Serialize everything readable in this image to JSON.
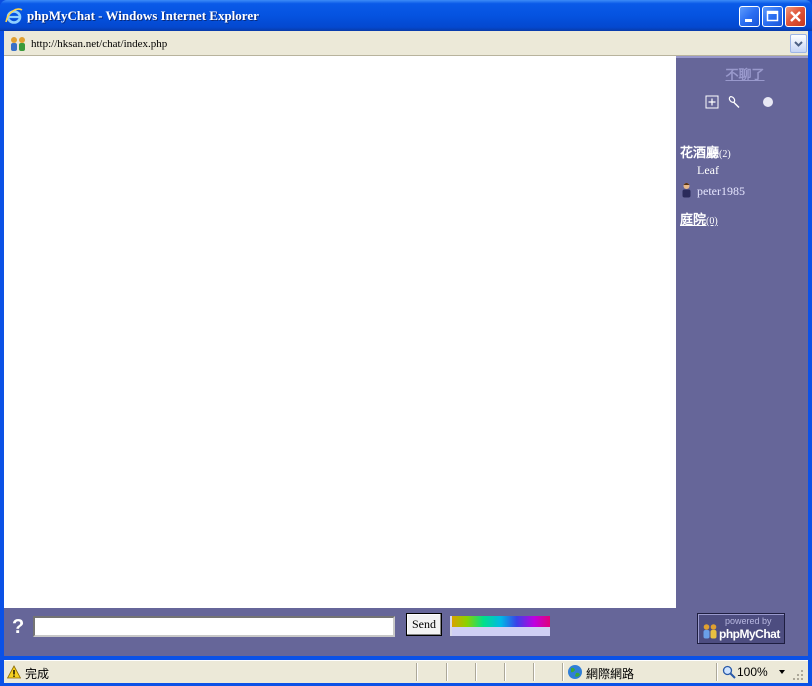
{
  "window": {
    "title": "phpMyChat - Windows Internet Explorer",
    "icon": "ie-icon"
  },
  "address_bar": {
    "url": "http://hksan.net/chat/index.php"
  },
  "sidebar": {
    "exit_label": "不聊了",
    "icons": [
      "plus-box-icon",
      "microphone-icon",
      "circle-icon"
    ],
    "rooms": [
      {
        "name": "花酒廳",
        "count": "(2)",
        "users": [
          {
            "name": "Leaf"
          },
          {
            "name": "peter1985",
            "icon": "user-icon"
          }
        ]
      },
      {
        "name": "庭院",
        "count": "(0)",
        "users": []
      }
    ]
  },
  "input_bar": {
    "help_label": "?",
    "message_value": "",
    "send_label": "Send"
  },
  "powered": {
    "line1": "powered by",
    "line2": "phpMyChat"
  },
  "status_bar": {
    "status_text": "完成",
    "zone_text": "網際網路",
    "zoom_text": "100%"
  },
  "colors": {
    "panel": "#666699",
    "titlebar": "#0553e0",
    "chrome": "#ece9d8"
  }
}
